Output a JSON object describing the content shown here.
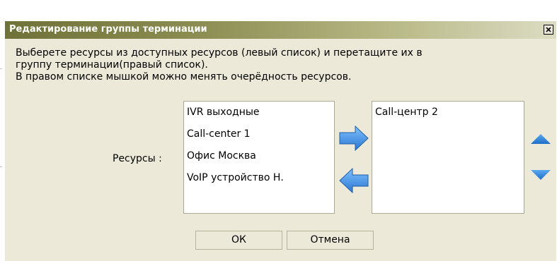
{
  "dialog": {
    "title": "Редактирование группы терминации",
    "close_label": "X",
    "instructions": [
      "Выберете ресурсы из доступных ресурсов (левый список) и перетащите их в",
      "группу терминации(правый список).",
      "В правом списке мышкой можно менять очерёдность ресурсов."
    ],
    "resources_label": "Ресурсы :",
    "available_resources": [
      "IVR выходные",
      "Call-center 1",
      "Офис Москва",
      "VoIP устройство Н."
    ],
    "group_resources": [
      "Call-центр 2"
    ],
    "ok_label": "ОК",
    "cancel_label": "Отмена"
  },
  "colors": {
    "dialog_bg": "#ece9d8",
    "titlebar_dark": "#6f7238",
    "arrow_blue": "#3c8ee0"
  }
}
